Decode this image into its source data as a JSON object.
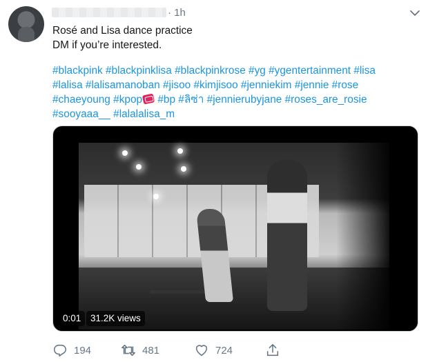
{
  "tweet": {
    "timestamp": "· 1h",
    "text_line1": "Rosé and Lisa dance practice",
    "text_line2": "DM if you’re interested.",
    "hashtags_line1": "#blackpink #blackpinklisa #blackpinkrose #yg #ygentertainment #lisa",
    "hashtags_line2": "#lalisa #lalisamanoban #jisoo #kimjisoo #jenniekim #jennie #rose",
    "hashtags_line3a": "#chaeyoung #kpop",
    "hashtags_line3b": " #bp #ลิซ่า #jennierubyjane #roses_are_rosie",
    "hashtags_line4": "#sooyaaa__ #lalalalisa_m"
  },
  "video": {
    "time": "0:01",
    "views": "31.2K views"
  },
  "actions": {
    "reply_count": "194",
    "retweet_count": "481",
    "like_count": "724"
  },
  "colors": {
    "link": "#1b95e0",
    "muted": "#657786",
    "text": "#14171a"
  },
  "icons": {
    "more": "chevron-down-icon",
    "reply": "reply-icon",
    "retweet": "retweet-icon",
    "like": "heart-icon",
    "share": "share-icon",
    "badge": "kpop-badge-icon"
  }
}
